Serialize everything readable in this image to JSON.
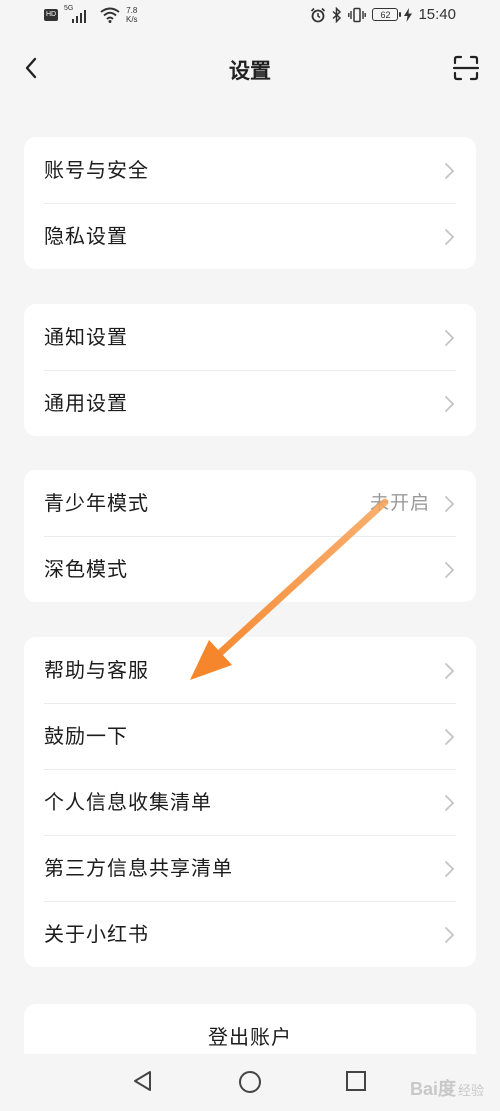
{
  "status_bar": {
    "hd_label": "HD",
    "network_label": "5G",
    "speed_value": "7.8",
    "speed_unit": "K/s",
    "battery_level": "62",
    "time": "15:40"
  },
  "header": {
    "title": "设置"
  },
  "groups": [
    {
      "items": [
        {
          "label": "账号与安全",
          "value": ""
        },
        {
          "label": "隐私设置",
          "value": ""
        }
      ]
    },
    {
      "items": [
        {
          "label": "通知设置",
          "value": ""
        },
        {
          "label": "通用设置",
          "value": ""
        }
      ]
    },
    {
      "items": [
        {
          "label": "青少年模式",
          "value": "未开启"
        },
        {
          "label": "深色模式",
          "value": ""
        }
      ]
    },
    {
      "items": [
        {
          "label": "帮助与客服",
          "value": ""
        },
        {
          "label": "鼓励一下",
          "value": ""
        },
        {
          "label": "个人信息收集清单",
          "value": ""
        },
        {
          "label": "第三方信息共享清单",
          "value": ""
        },
        {
          "label": "关于小红书",
          "value": ""
        }
      ]
    }
  ],
  "logout": {
    "label": "登出账户"
  },
  "watermark": {
    "brand": "Bai度",
    "sub": "经验"
  },
  "colors": {
    "background": "#f5f5f5",
    "card": "#ffffff",
    "annotation_arrow": "#f5862b",
    "secondary_text": "#9a9a9a"
  },
  "icons": {
    "back": "chevron-left-icon",
    "scan": "scan-icon",
    "row_chevron": "chevron-right-icon",
    "nav_back": "triangle-back-icon",
    "nav_home": "circle-home-icon",
    "nav_recents": "square-recents-icon"
  }
}
